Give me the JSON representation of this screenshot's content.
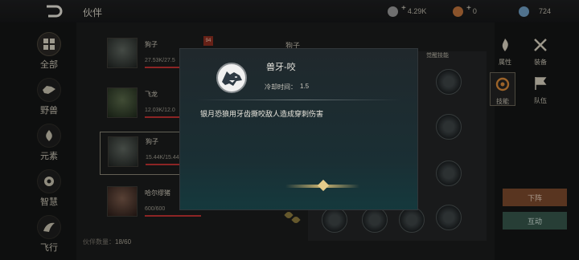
{
  "header": {
    "title": "伙伴",
    "resources": [
      {
        "icon": "coin-icon",
        "value": "4.29K",
        "color": "#9a9a9a"
      },
      {
        "icon": "ember-icon",
        "value": "0",
        "color": "#c0743c"
      },
      {
        "icon": "crystal-icon",
        "value": "724",
        "color": "#6f9ec4"
      }
    ]
  },
  "leftnav": [
    {
      "label": "全部",
      "icon": "grid-icon"
    },
    {
      "label": "野兽",
      "icon": "beast-icon"
    },
    {
      "label": "元素",
      "icon": "element-icon"
    },
    {
      "label": "智慧",
      "icon": "wisdom-icon"
    },
    {
      "label": "飞行",
      "icon": "flight-icon"
    }
  ],
  "cards": [
    {
      "name": "狗子",
      "hp": "27.53K/27.5"
    },
    {
      "name": "飞龙",
      "hp": "12.03K/12.0"
    },
    {
      "name": "狗子",
      "hp": "15.44K/15.44"
    },
    {
      "name": "哈尔缪猪",
      "hp": "600/600"
    }
  ],
  "under": {
    "name": "狗子",
    "awaken": "觉醒技能"
  },
  "right_menu": [
    {
      "label": "属性",
      "icon": "fire-icon"
    },
    {
      "label": "装备",
      "icon": "swords-icon"
    },
    {
      "label": "技能",
      "icon": "skill-icon"
    },
    {
      "label": "队伍",
      "icon": "flag-icon"
    }
  ],
  "buttons": {
    "down": "下阵",
    "interact": "互动"
  },
  "footer": {
    "count_label": "伙伴数量：",
    "count_value": "18/60"
  },
  "popup": {
    "skill_name": "兽牙-咬",
    "cd_label": "冷却时间：",
    "cd_value": "1.5",
    "description": "银月恐狼用牙齿撕咬敌人造成穿刺伤害"
  },
  "colors": {
    "accent": "#e6cc8a",
    "down": "#7c4a2d",
    "interact": "#36574b"
  }
}
